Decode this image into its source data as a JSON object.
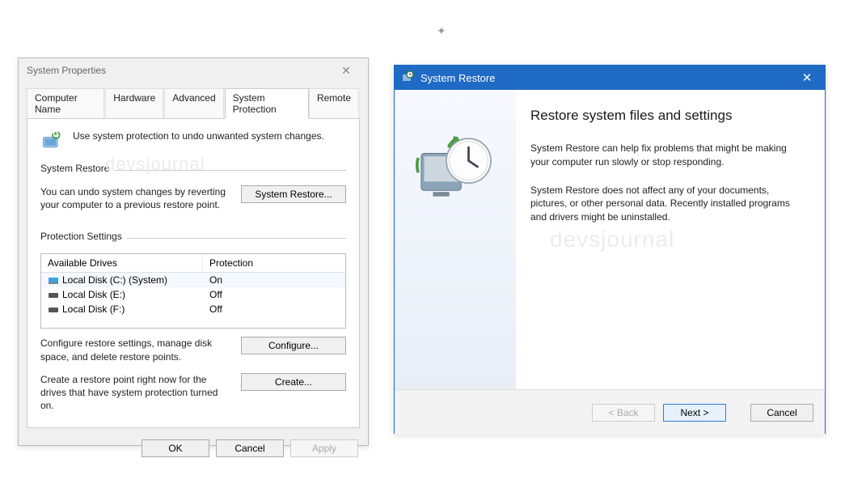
{
  "watermark": "devsjournal",
  "sysprops": {
    "title": "System Properties",
    "tabs": [
      "Computer Name",
      "Hardware",
      "Advanced",
      "System Protection",
      "Remote"
    ],
    "active_tab_index": 3,
    "intro": "Use system protection to undo unwanted system changes.",
    "section_restore_title": "System Restore",
    "restore_desc": "You can undo system changes by reverting your computer to a previous restore point.",
    "btn_system_restore": "System Restore...",
    "section_protection_title": "Protection Settings",
    "table": {
      "col1": "Available Drives",
      "col2": "Protection",
      "rows": [
        {
          "name": "Local Disk (C:) (System)",
          "prot": "On",
          "system": true
        },
        {
          "name": "Local Disk (E:)",
          "prot": "Off",
          "system": false
        },
        {
          "name": "Local Disk (F:)",
          "prot": "Off",
          "system": false
        }
      ]
    },
    "configure_desc": "Configure restore settings, manage disk space, and delete restore points.",
    "btn_configure": "Configure...",
    "create_desc": "Create a restore point right now for the drives that have system protection turned on.",
    "btn_create": "Create...",
    "btn_ok": "OK",
    "btn_cancel": "Cancel",
    "btn_apply": "Apply"
  },
  "wizard": {
    "title": "System Restore",
    "heading": "Restore system files and settings",
    "p1": "System Restore can help fix problems that might be making your computer run slowly or stop responding.",
    "p2": "System Restore does not affect any of your documents, pictures, or other personal data. Recently installed programs and drivers might be uninstalled.",
    "btn_back": "< Back",
    "btn_next": "Next >",
    "btn_cancel": "Cancel"
  }
}
